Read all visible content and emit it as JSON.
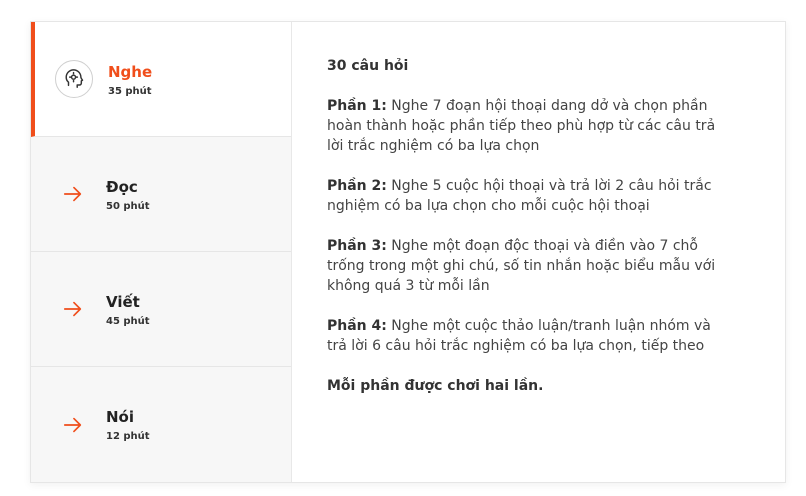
{
  "tabs": [
    {
      "title": "Nghe",
      "duration": "35 phút",
      "icon": "head-listening-icon",
      "active": true
    },
    {
      "title": "Đọc",
      "duration": "50 phút",
      "icon": "arrow-right-icon",
      "active": false
    },
    {
      "title": "Viết",
      "duration": "45 phút",
      "icon": "arrow-right-icon",
      "active": false
    },
    {
      "title": "Nói",
      "duration": "12 phút",
      "icon": "arrow-right-icon",
      "active": false
    }
  ],
  "content": {
    "question_count": "30 câu hỏi",
    "parts": [
      {
        "label": "Phần 1:",
        "text": " Nghe 7 đoạn hội thoại dang dở và chọn phần hoàn thành hoặc phần tiếp theo phù hợp từ các câu trả lời trắc nghiệm có ba lựa chọn"
      },
      {
        "label": "Phần 2:",
        "text": " Nghe 5 cuộc hội thoại và trả lời 2 câu hỏi trắc nghiệm có ba lựa chọn cho mỗi cuộc hội thoại"
      },
      {
        "label": "Phần 3:",
        "text": " Nghe một đoạn độc thoại và điền vào 7 chỗ trống trong một ghi chú, số tin nhắn hoặc biểu mẫu với không quá 3 từ mỗi lần"
      },
      {
        "label": "Phần 4:",
        "text": " Nghe một cuộc thảo luận/tranh luận nhóm và trả lời 6 câu hỏi trắc nghiệm có ba lựa chọn, tiếp theo"
      }
    ],
    "note": "Mỗi phần được chơi hai lần."
  },
  "colors": {
    "accent": "#f04e1b"
  }
}
